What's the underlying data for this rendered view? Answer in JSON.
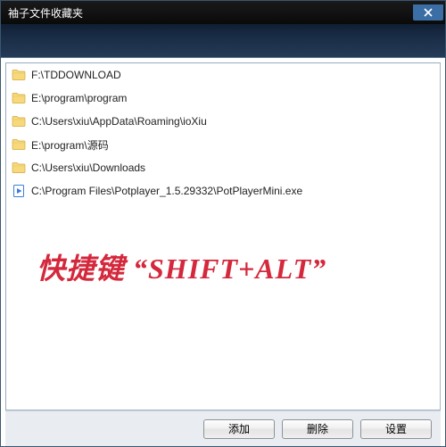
{
  "window": {
    "title": "袖子文件收藏夹"
  },
  "items": [
    {
      "type": "folder",
      "path": "F:\\TDDOWNLOAD"
    },
    {
      "type": "folder",
      "path": "E:\\program\\program"
    },
    {
      "type": "folder",
      "path": "C:\\Users\\xiu\\AppData\\Roaming\\ioXiu"
    },
    {
      "type": "folder",
      "path": "E:\\program\\源码"
    },
    {
      "type": "folder",
      "path": "C:\\Users\\xiu\\Downloads"
    },
    {
      "type": "file",
      "path": "C:\\Program Files\\Potplayer_1.5.29332\\PotPlayerMini.exe"
    }
  ],
  "overlay": {
    "text": "快捷键 “SHIFT+ALT”"
  },
  "buttons": {
    "add": "添加",
    "delete": "删除",
    "settings": "设置"
  }
}
